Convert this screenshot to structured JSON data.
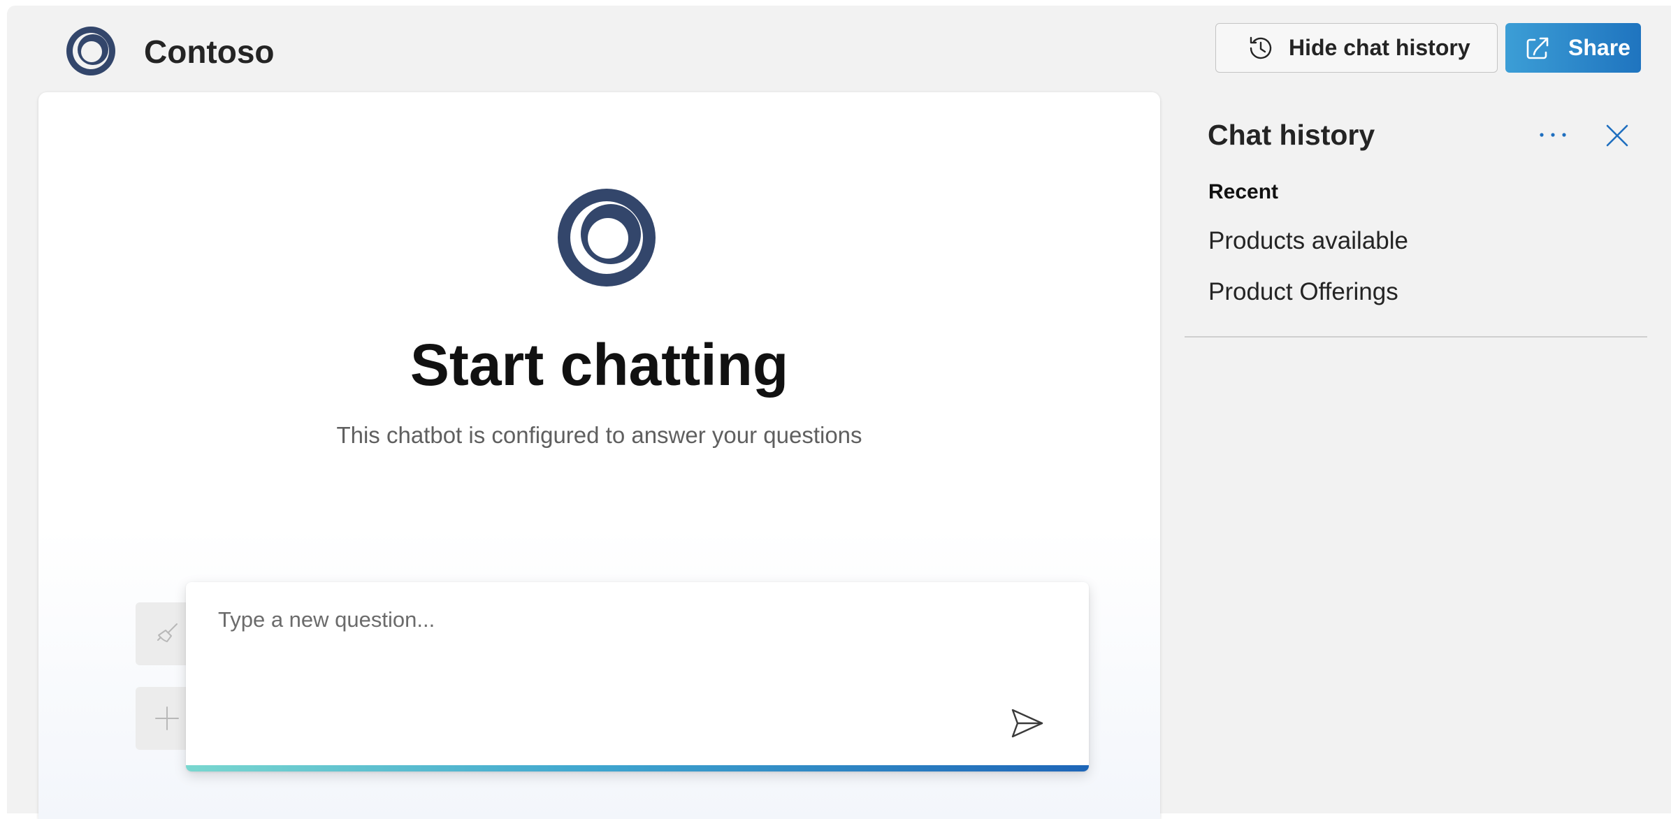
{
  "header": {
    "title": "Contoso",
    "logo_icon": "contoso-ring-logo",
    "hide_history_label": "Hide chat history",
    "hide_history_icon": "history-icon",
    "share_label": "Share",
    "share_icon": "share-icon"
  },
  "chat": {
    "logo_icon": "contoso-ring-logo",
    "title": "Start chatting",
    "subtitle": "This chatbot is configured to answer your questions",
    "input_placeholder": "Type a new question...",
    "clear_icon": "broom-icon",
    "new_chat_icon": "plus-icon",
    "send_icon": "send-icon"
  },
  "history": {
    "title": "Chat history",
    "more_icon": "more-horizontal-icon",
    "close_icon": "close-icon",
    "section_label": "Recent",
    "items": [
      {
        "label": "Products available"
      },
      {
        "label": "Product Offerings"
      }
    ]
  },
  "colors": {
    "logo": "#33466b",
    "share_button_start": "#3c9ed6",
    "share_button_end": "#1f74bf",
    "accent_blue": "#1f6fbf",
    "input_accent_start": "#79d7cf",
    "input_accent_end": "#1e66b8",
    "background": "#f2f2f2"
  }
}
